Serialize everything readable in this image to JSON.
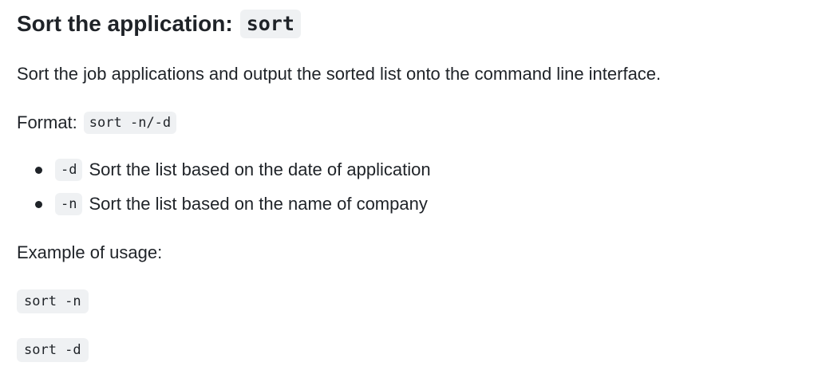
{
  "heading": {
    "text": "Sort the application:",
    "code": "sort"
  },
  "description": "Sort the job applications and output the sorted list onto the command line interface.",
  "format": {
    "label": "Format:",
    "code": "sort -n/-d"
  },
  "options": [
    {
      "flag": "-d",
      "text": "Sort the list based on the date of application"
    },
    {
      "flag": "-n",
      "text": "Sort the list based on the name of company"
    }
  ],
  "example": {
    "label": "Example of usage:",
    "commands": [
      "sort -n",
      "sort -d"
    ]
  }
}
